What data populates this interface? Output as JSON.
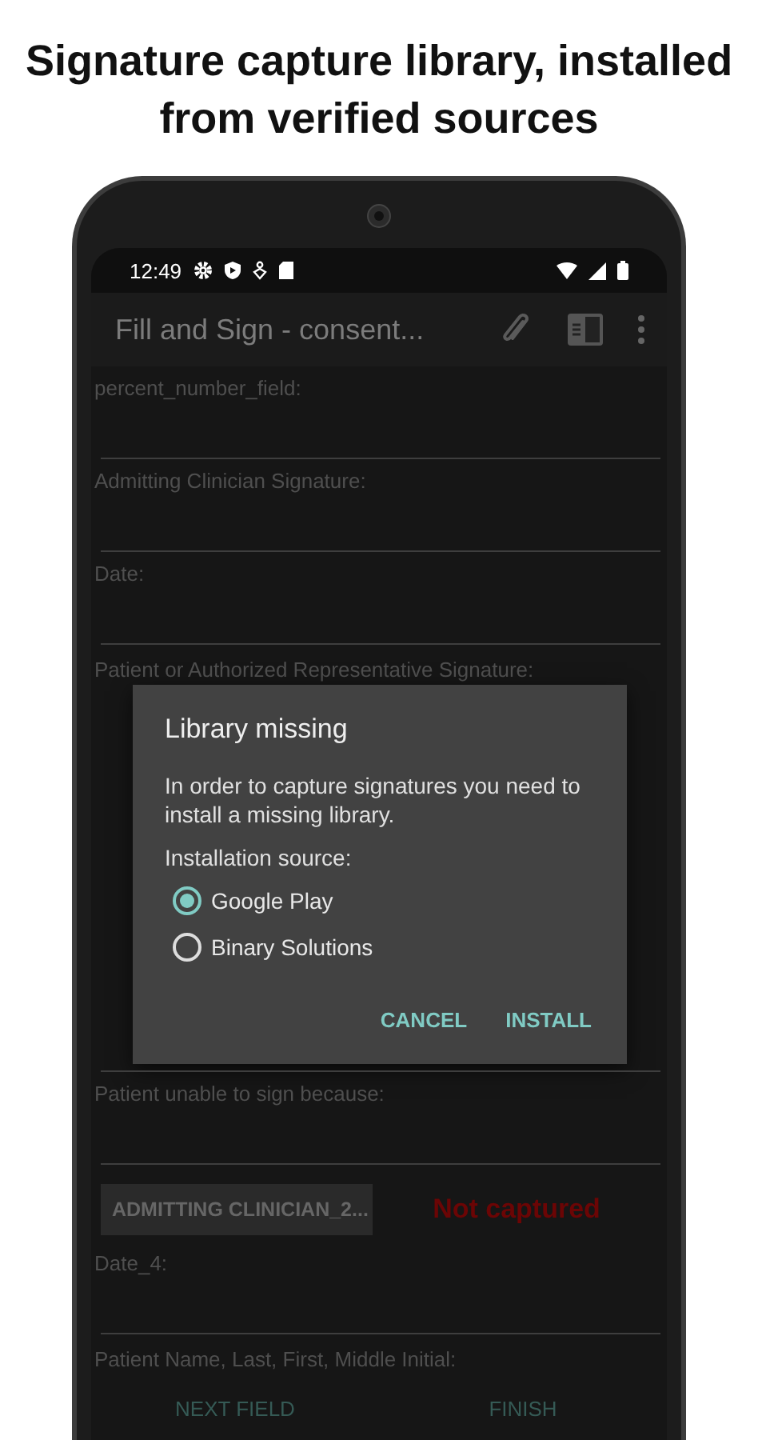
{
  "headline": "Signature capture library, installed from verified sources",
  "status_bar": {
    "time": "12:49"
  },
  "app_bar": {
    "title": "Fill and Sign - consent..."
  },
  "fields_before": [
    {
      "kind": "text",
      "label": "percent_number_field:"
    },
    {
      "kind": "text",
      "label": "Admitting Clinician Signature:"
    },
    {
      "kind": "text",
      "label": "Date:"
    },
    {
      "kind": "label",
      "label": "Patient or Authorized Representative Signature:"
    }
  ],
  "dialog": {
    "title": "Library missing",
    "message": "In order to capture signatures you need to install a missing library.",
    "section_label": "Installation source:",
    "options": [
      {
        "label": "Google Play",
        "selected": true
      },
      {
        "label": "Binary Solutions",
        "selected": false
      }
    ],
    "buttons": [
      "CANCEL",
      "INSTALL"
    ]
  },
  "fields_after": [
    {
      "kind": "text",
      "label": "Patient unable to sign because:"
    },
    {
      "kind": "signature",
      "button": "ADMITTING CLINICIAN_2...",
      "status": "Not captured"
    },
    {
      "kind": "text",
      "label": "Date_4:"
    },
    {
      "kind": "label",
      "label": "Patient Name, Last, First, Middle Initial:"
    }
  ],
  "bottom_bar": {
    "buttons": [
      "NEXT FIELD",
      "FINISH"
    ]
  }
}
